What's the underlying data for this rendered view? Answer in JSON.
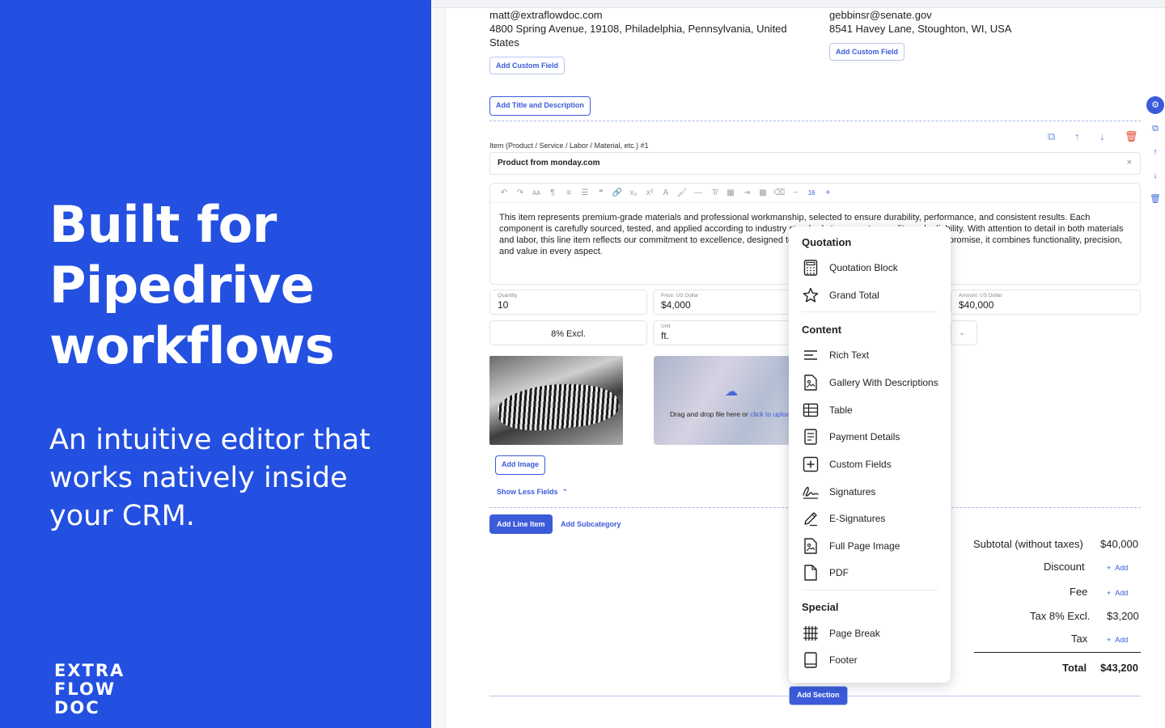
{
  "promo": {
    "title": "Built for Pipedrive workflows",
    "subtitle": "An intuitive editor that works natively inside your CRM.",
    "logo_line1": "EXTRA",
    "logo_line2": "FLOW",
    "logo_line3": "DOC"
  },
  "document": {
    "sender": {
      "email": "matt@extraflowdoc.com",
      "address": "4800 Spring Avenue, 19108, Philadelphia, Pennsylvania, United States",
      "custom_field_label": "Add Custom Field"
    },
    "recipient": {
      "email": "gebbinsr@senate.gov",
      "address": "8541 Havey Lane, Stoughton, WI, USA",
      "custom_field_label": "Add Custom Field"
    },
    "add_title_label": "Add Title and Description",
    "item": {
      "label": "Item (Product / Service / Labor / Material, etc.) #1",
      "title": "Product from monday.com",
      "clear": "×",
      "description": "This item represents premium-grade materials and professional workmanship, selected to ensure durability, performance, and consistent results. Each component is carefully sourced, tested, and applied according to industry standards to guarantee quality and reliability. With attention to detail in both materials and labor, this line item reflects our commitment to excellence, designed to meet project requirements without compromise, it combines functionality, precision, and value in every aspect.",
      "font_size": "16",
      "quantity_label": "Quantity",
      "quantity": "10",
      "price_label": "Price: US Dollar",
      "price": "$4,000",
      "amount_label": "Amount: US Dollar",
      "amount": "$40,000",
      "tax": "8% Excl.",
      "unit_label": "Unit",
      "unit": "ft.",
      "dropzone_text": "Drag and drop file here or ",
      "dropzone_link": "click to upload",
      "add_image_label": "Add Image",
      "show_less_label": "Show Less Fields"
    },
    "add_line_item_label": "Add Line Item",
    "add_subcategory_label": "Add Subcategory",
    "add_section_label": "Add Section",
    "totals": {
      "subtotal_label": "Subtotal (without taxes)",
      "subtotal": "$40,000",
      "discount_label": "Discount",
      "fee_label": "Fee",
      "tax_excl_label": "Tax 8% Excl.",
      "tax_excl": "$3,200",
      "tax_label": "Tax",
      "total_label": "Total",
      "total": "$43,200",
      "add_label": "Add"
    }
  },
  "menu": {
    "quotation_heading": "Quotation",
    "quotation_items": [
      "Quotation Block",
      "Grand Total"
    ],
    "content_heading": "Content",
    "content_items": [
      "Rich Text",
      "Gallery With Descriptions",
      "Table",
      "Payment Details",
      "Custom Fields",
      "Signatures",
      "E-Signatures",
      "Full Page Image",
      "PDF"
    ],
    "special_heading": "Special",
    "special_items": [
      "Page Break",
      "Footer"
    ]
  },
  "colors": {
    "brand": "#2350e0",
    "accent": "#3b5bd9",
    "danger": "#e0452f"
  }
}
